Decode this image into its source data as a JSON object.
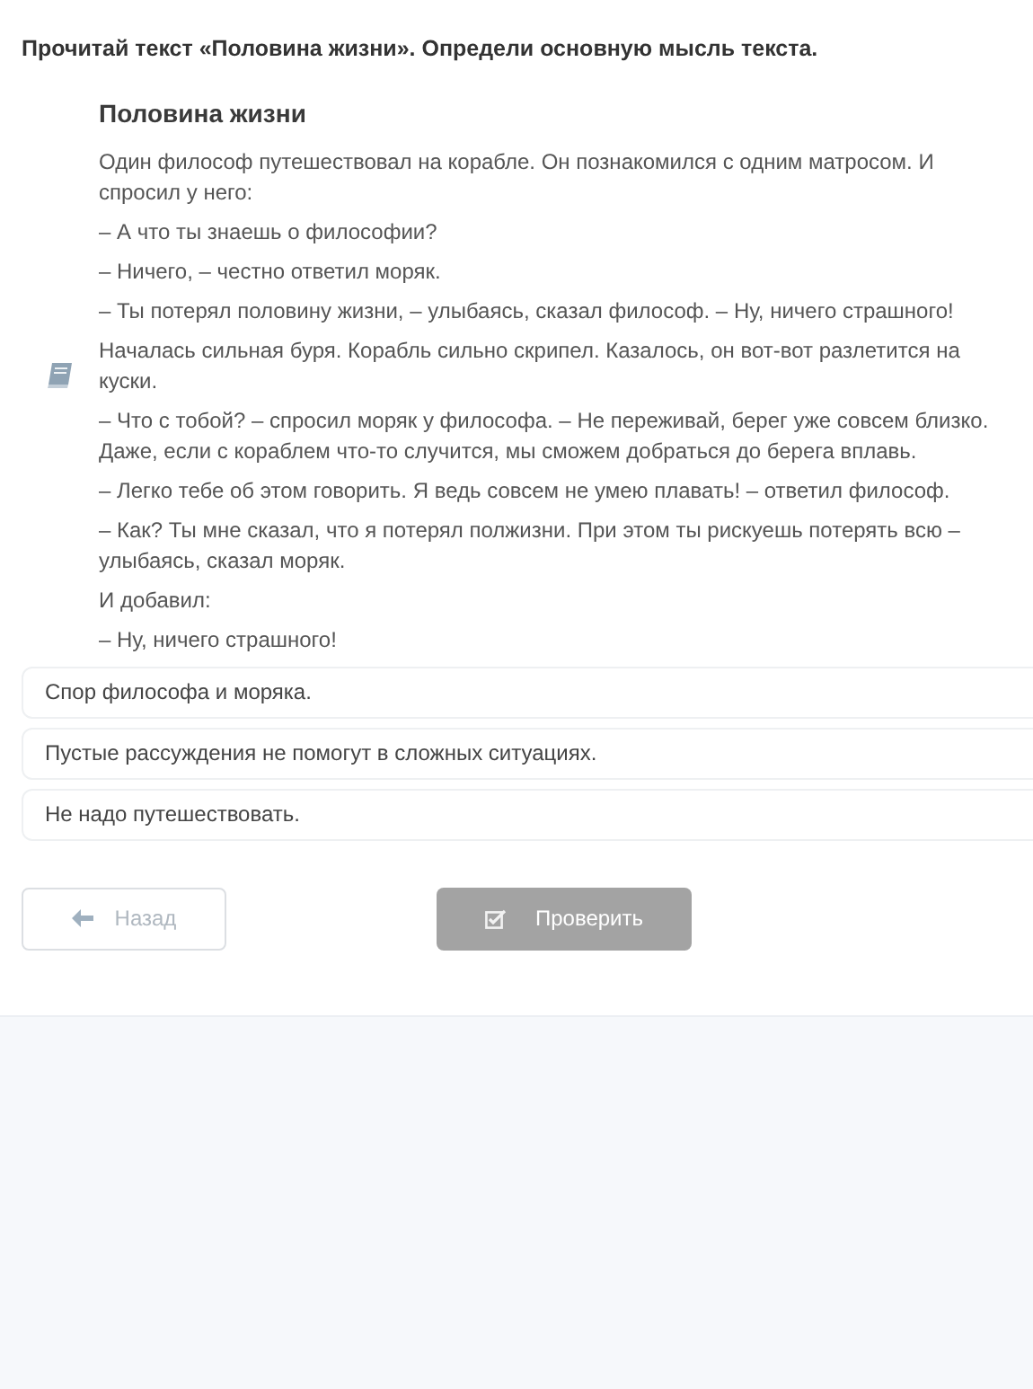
{
  "question": "Прочитай текст «Половина жизни». Определи основную мысль текста.",
  "reading": {
    "title": "Половина жизни",
    "paragraphs": [
      "Один философ путешествовал на корабле. Он познакомился с одним матросом. И спросил у него:",
      "– А что ты знаешь о философии?",
      "– Ничего, – честно ответил моряк.",
      "– Ты потерял половину жизни, – улыбаясь, сказал философ. – Ну, ничего страшного!",
      "Началась сильная буря. Корабль сильно скрипел. Казалось, он вот-вот разлетится на куски.",
      "– Что с тобой? – спросил моряк у философа. – Не переживай, берег уже совсем близко. Даже, если с кораблем что-то случится, мы сможем добраться до берега вплавь.",
      "– Легко тебе об этом говорить. Я ведь совсем не умею плавать! – ответил философ.",
      "– Как? Ты мне сказал, что я потерял полжизни. При этом ты рискуешь потерять всю – улыбаясь, сказал моряк.",
      "И добавил:",
      "– Ну, ничего страшного!"
    ]
  },
  "options": [
    {
      "label": "Спор философа и моряка.",
      "selected": false
    },
    {
      "label": "Пустые рассуждения не помогут в сложных ситуациях.",
      "selected": false
    },
    {
      "label": "Не надо путешествовать.",
      "selected": false
    }
  ],
  "buttons": {
    "back": {
      "label": "Назад"
    },
    "check": {
      "label": "Проверить",
      "disabled": true
    }
  }
}
